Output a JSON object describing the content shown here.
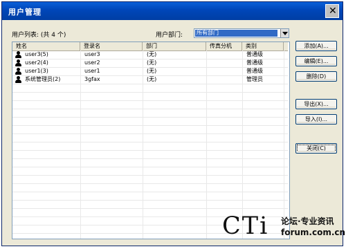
{
  "window": {
    "title": "用户管理",
    "close_symbol": "✕"
  },
  "user_list_label": "用户列表:  (共 4 个)",
  "department_label": "用户部门:",
  "department_select": {
    "value": "所有部门"
  },
  "table": {
    "columns": [
      "姓名",
      "登录名",
      "部门",
      "传真分机",
      "类别"
    ],
    "rows": [
      {
        "name": "user3(5)",
        "login": "user3",
        "dept": "(无)",
        "fax": "",
        "type": "普通级"
      },
      {
        "name": "user2(4)",
        "login": "user2",
        "dept": "(无)",
        "fax": "",
        "type": "普通级"
      },
      {
        "name": "user1(3)",
        "login": "user1",
        "dept": "(无)",
        "fax": "",
        "type": "普通级"
      },
      {
        "name": "系统管理员(2)",
        "login": "3gfax",
        "dept": "(无)",
        "fax": "",
        "type": "管理员"
      }
    ]
  },
  "buttons": {
    "add": "添加(A)...",
    "edit": "编辑(E)...",
    "delete": "删除(D)",
    "export": "导出(X)...",
    "import": "导入(I)...",
    "close": "关闭(C)"
  },
  "watermark": {
    "brand": "CTi",
    "line1": "论坛·专业资讯",
    "line2": "forum.com.cn"
  }
}
